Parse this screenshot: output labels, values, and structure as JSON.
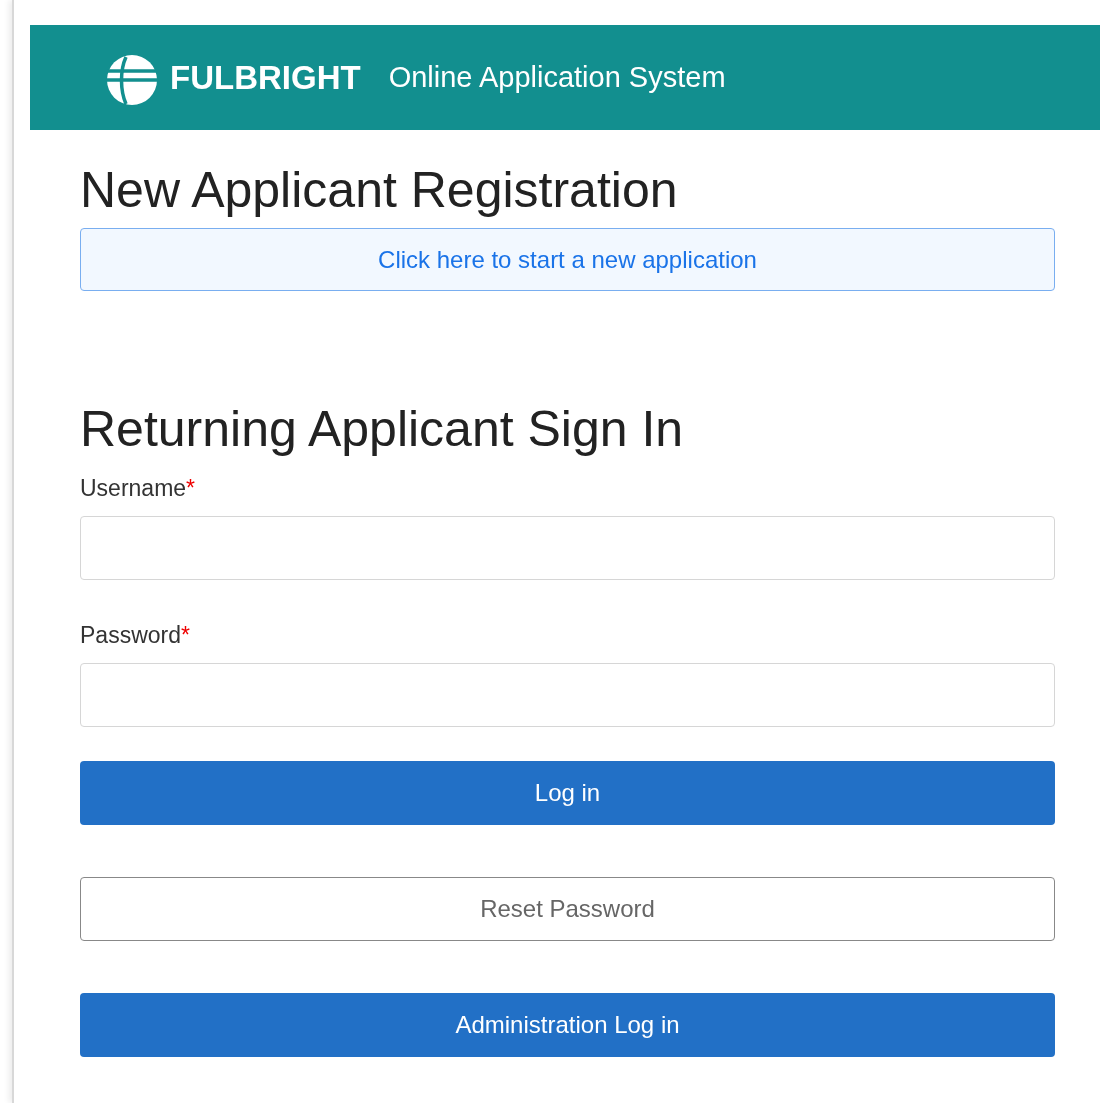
{
  "header": {
    "brand": "FULBRIGHT",
    "title": "Online Application System"
  },
  "registration": {
    "heading": "New Applicant Registration",
    "link_button": "Click here to start a new application"
  },
  "sign_in": {
    "heading": "Returning Applicant Sign In",
    "fields": [
      {
        "label": "Username",
        "required_mark": "*"
      },
      {
        "label": "Password",
        "required_mark": "*"
      }
    ],
    "buttons": [
      {
        "label": "Log in",
        "kind": "primary"
      },
      {
        "label": "Reset Password",
        "kind": "secondary"
      },
      {
        "label": "Administration Log in",
        "kind": "primary"
      }
    ]
  }
}
